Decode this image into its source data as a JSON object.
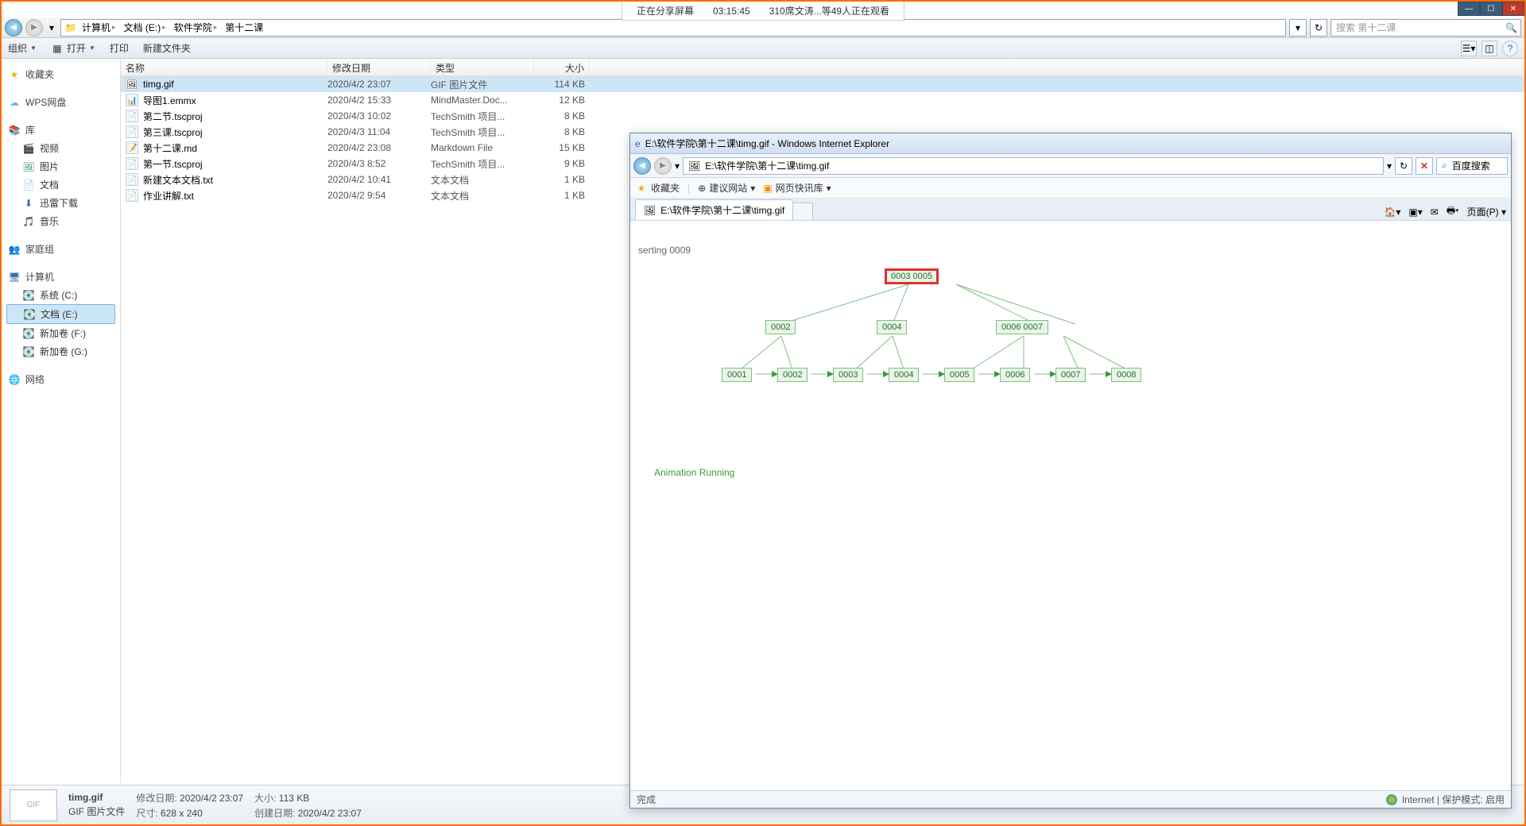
{
  "share_bar": {
    "status": "正在分享屏幕",
    "time": "03:15:45",
    "viewers": "310席文涛...等49人正在观看"
  },
  "window_controls": {
    "min": "—",
    "max": "☐",
    "close": "✕"
  },
  "breadcrumb": {
    "drive_icon": "📁",
    "parts": [
      "计算机",
      "文档 (E:)",
      "软件学院",
      "第十二课"
    ]
  },
  "search": {
    "placeholder": "搜索 第十二课"
  },
  "toolbar": {
    "organize": "组织",
    "open": "打开",
    "print": "打印",
    "new_folder": "新建文件夹"
  },
  "sidebar": {
    "favorites": {
      "label": "收藏夹"
    },
    "wps": {
      "label": "WPS网盘"
    },
    "libraries": {
      "label": "库",
      "items": [
        {
          "icon": "🎬",
          "label": "视频"
        },
        {
          "icon": "🖼",
          "label": "图片"
        },
        {
          "icon": "📄",
          "label": "文档"
        },
        {
          "icon": "⬇",
          "label": "迅雷下载"
        },
        {
          "icon": "🎵",
          "label": "音乐"
        }
      ]
    },
    "homegroup": {
      "label": "家庭组"
    },
    "computer": {
      "label": "计算机",
      "items": [
        {
          "icon": "💽",
          "label": "系统 (C:)"
        },
        {
          "icon": "💽",
          "label": "文档 (E:)",
          "selected": true
        },
        {
          "icon": "💽",
          "label": "新加卷 (F:)"
        },
        {
          "icon": "💽",
          "label": "新加卷 (G:)"
        }
      ]
    },
    "network": {
      "label": "网络"
    }
  },
  "columns": {
    "name": "名称",
    "date": "修改日期",
    "type": "类型",
    "size": "大小"
  },
  "files": [
    {
      "icon": "🖼",
      "name": "timg.gif",
      "date": "2020/4/2 23:07",
      "type": "GIF 图片文件",
      "size": "114 KB",
      "selected": true
    },
    {
      "icon": "📊",
      "name": "导图1.emmx",
      "date": "2020/4/2 15:33",
      "type": "MindMaster.Doc...",
      "size": "12 KB"
    },
    {
      "icon": "📄",
      "name": "第二节.tscproj",
      "date": "2020/4/3 10:02",
      "type": "TechSmith 项目...",
      "size": "8 KB"
    },
    {
      "icon": "📄",
      "name": "第三课.tscproj",
      "date": "2020/4/3 11:04",
      "type": "TechSmith 项目...",
      "size": "8 KB"
    },
    {
      "icon": "📝",
      "name": "第十二课.md",
      "date": "2020/4/2 23:08",
      "type": "Markdown File",
      "size": "15 KB"
    },
    {
      "icon": "📄",
      "name": "第一节.tscproj",
      "date": "2020/4/3 8:52",
      "type": "TechSmith 项目...",
      "size": "9 KB"
    },
    {
      "icon": "📄",
      "name": "新建文本文档.txt",
      "date": "2020/4/2 10:41",
      "type": "文本文档",
      "size": "1 KB"
    },
    {
      "icon": "📄",
      "name": "作业讲解.txt",
      "date": "2020/4/2 9:54",
      "type": "文本文档",
      "size": "1 KB"
    }
  ],
  "details": {
    "filename": "timg.gif",
    "filetype": "GIF 图片文件",
    "mod_label": "修改日期:",
    "mod_value": "2020/4/2 23:07",
    "dim_label": "尺寸:",
    "dim_value": "628 x 240",
    "size_label": "大小:",
    "size_value": "113 KB",
    "created_label": "创建日期:",
    "created_value": "2020/4/2 23:07"
  },
  "ie": {
    "title": "E:\\软件学院\\第十二课\\timg.gif - Windows Internet Explorer",
    "url": "E:\\软件学院\\第十二课\\timg.gif",
    "baidu": "百度搜索",
    "fav": "收藏夹",
    "suggest": "建议网站",
    "quick": "网页快讯库",
    "tab": "E:\\软件学院\\第十二课\\timg.gif",
    "page_menu": "页面(P)",
    "status_done": "完成",
    "status_zone": "Internet | 保护模式: 启用"
  },
  "diagram": {
    "label": "serting 0009",
    "running": "Animation Running",
    "root": "0003    0005",
    "mid": [
      "0002",
      "0004",
      "0006   0007"
    ],
    "leaf": [
      "0001",
      "0002",
      "0003",
      "0004",
      "0005",
      "0006",
      "0007",
      "0008"
    ]
  }
}
